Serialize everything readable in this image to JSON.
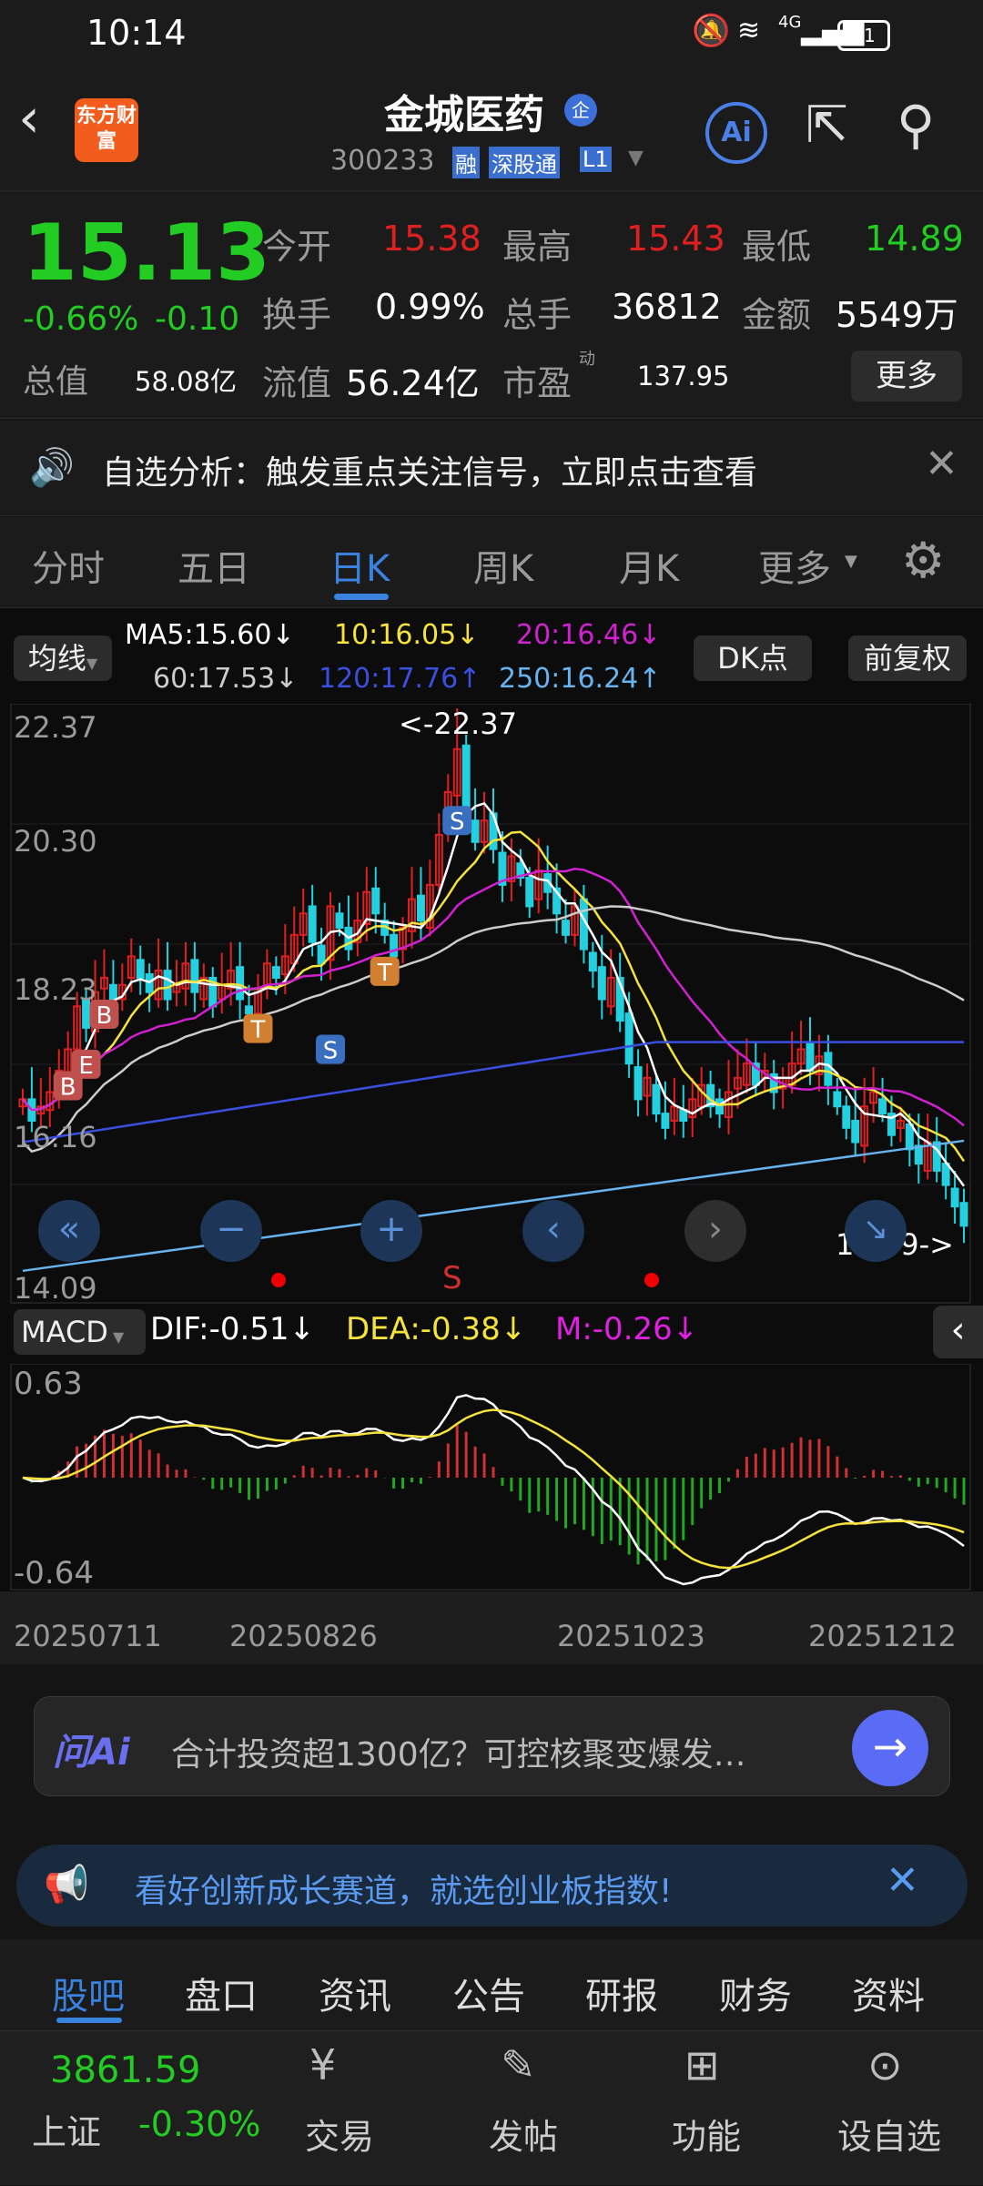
{
  "status": {
    "time": "10:14",
    "battery": "81",
    "network": "4G"
  },
  "header": {
    "title": "金城医药",
    "badge": "企",
    "code": "300233",
    "tags": [
      "融",
      "深股通",
      "L1"
    ],
    "logo": "东方财富",
    "ai": "Ai"
  },
  "quote": {
    "price": "15.13",
    "pct": "-0.66%",
    "chg": "-0.10",
    "open_label": "今开",
    "open": "15.38",
    "high_label": "最高",
    "high": "15.43",
    "low_label": "最低",
    "low": "14.89",
    "turnover_label": "换手",
    "turnover": "0.99%",
    "vol_label": "总手",
    "vol": "36812",
    "amt_label": "金额",
    "amt": "5549万",
    "mcap_label": "总值",
    "mcap": "58.08亿",
    "float_label": "流值",
    "float": "56.24亿",
    "pe_label": "市盈",
    "pe_sup": "动",
    "pe": "137.95",
    "more": "更多"
  },
  "notice": {
    "text": "自选分析：触发重点关注信号，立即点击查看"
  },
  "tabs": [
    "分时",
    "五日",
    "日K",
    "周K",
    "月K",
    "更多"
  ],
  "ma": {
    "selector": "均线",
    "ma5": "MA5:15.60↓",
    "ma10": "10:16.05↓",
    "ma20": "20:16.46↓",
    "ma60": "60:17.53↓",
    "ma120": "120:17.76↑",
    "ma250": "250:16.24↑",
    "dk": "DK点",
    "adjust": "前复权"
  },
  "colors": {
    "ma5": "#ffffff",
    "ma10": "#f5e23a",
    "ma20": "#d020d0",
    "ma60": "#cccccc",
    "ma120": "#3a4fe0",
    "ma250": "#66b3f0",
    "up": "#e02020",
    "down": "#22d0e0"
  },
  "chart_data": {
    "type": "candlestick",
    "yticks": [
      "22.37",
      "20.30",
      "18.23",
      "16.16",
      "14.09"
    ],
    "ylim": [
      14.09,
      22.37
    ],
    "max_label": "<-22.37",
    "min_label": "14.89->",
    "closes": [
      16.9,
      16.6,
      16.8,
      17.0,
      17.3,
      17.6,
      18.2,
      17.9,
      18.4,
      18.6,
      18.3,
      18.5,
      18.9,
      18.6,
      18.4,
      18.7,
      18.3,
      18.5,
      18.8,
      18.4,
      18.6,
      18.2,
      18.5,
      18.7,
      18.3,
      18.1,
      18.4,
      18.8,
      18.6,
      18.9,
      19.2,
      19.5,
      19.1,
      18.8,
      19.6,
      19.3,
      19.0,
      19.4,
      19.8,
      19.5,
      19.2,
      18.9,
      19.3,
      19.7,
      19.4,
      19.9,
      20.6,
      21.2,
      21.8,
      20.9,
      20.5,
      20.8,
      20.4,
      19.9,
      20.3,
      20.0,
      19.6,
      20.1,
      19.8,
      19.5,
      19.2,
      19.6,
      19.0,
      18.7,
      18.3,
      18.6,
      18.0,
      17.4,
      16.9,
      17.2,
      16.7,
      16.5,
      16.8,
      16.6,
      16.9,
      17.1,
      16.8,
      16.7,
      17.0,
      17.2,
      17.4,
      17.1,
      17.3,
      17.0,
      17.2,
      17.4,
      17.6,
      17.3,
      17.5,
      17.1,
      16.8,
      16.5,
      16.3,
      16.8,
      17.0,
      16.7,
      16.4,
      16.6,
      16.2,
      16.0,
      16.3,
      15.9,
      15.7,
      15.4,
      15.13
    ],
    "signals": [
      "B",
      "E",
      "B",
      "T",
      "S",
      "T",
      "S"
    ],
    "nav_dot_label": "S"
  },
  "macd": {
    "selector": "MACD",
    "dif": "DIF:-0.51↓",
    "dea": "DEA:-0.38↓",
    "m": "M:-0.26↓",
    "ymax": "0.63",
    "ymin": "-0.64",
    "dates": [
      "20250711",
      "20250826",
      "20251023",
      "20251212"
    ]
  },
  "ai_bar": {
    "logo": "问Ai",
    "text": "合计投资超1300亿？可控核聚变爆发…"
  },
  "ad": {
    "text": "看好创新成长赛道，就选创业板指数!"
  },
  "bottom_tabs": [
    "股吧",
    "盘口",
    "资讯",
    "公告",
    "研报",
    "财务",
    "资料"
  ],
  "footer": {
    "index_value": "3861.59",
    "index_name": "上证",
    "index_pct": "-0.30%",
    "items": [
      "交易",
      "发帖",
      "功能",
      "设自选"
    ]
  }
}
